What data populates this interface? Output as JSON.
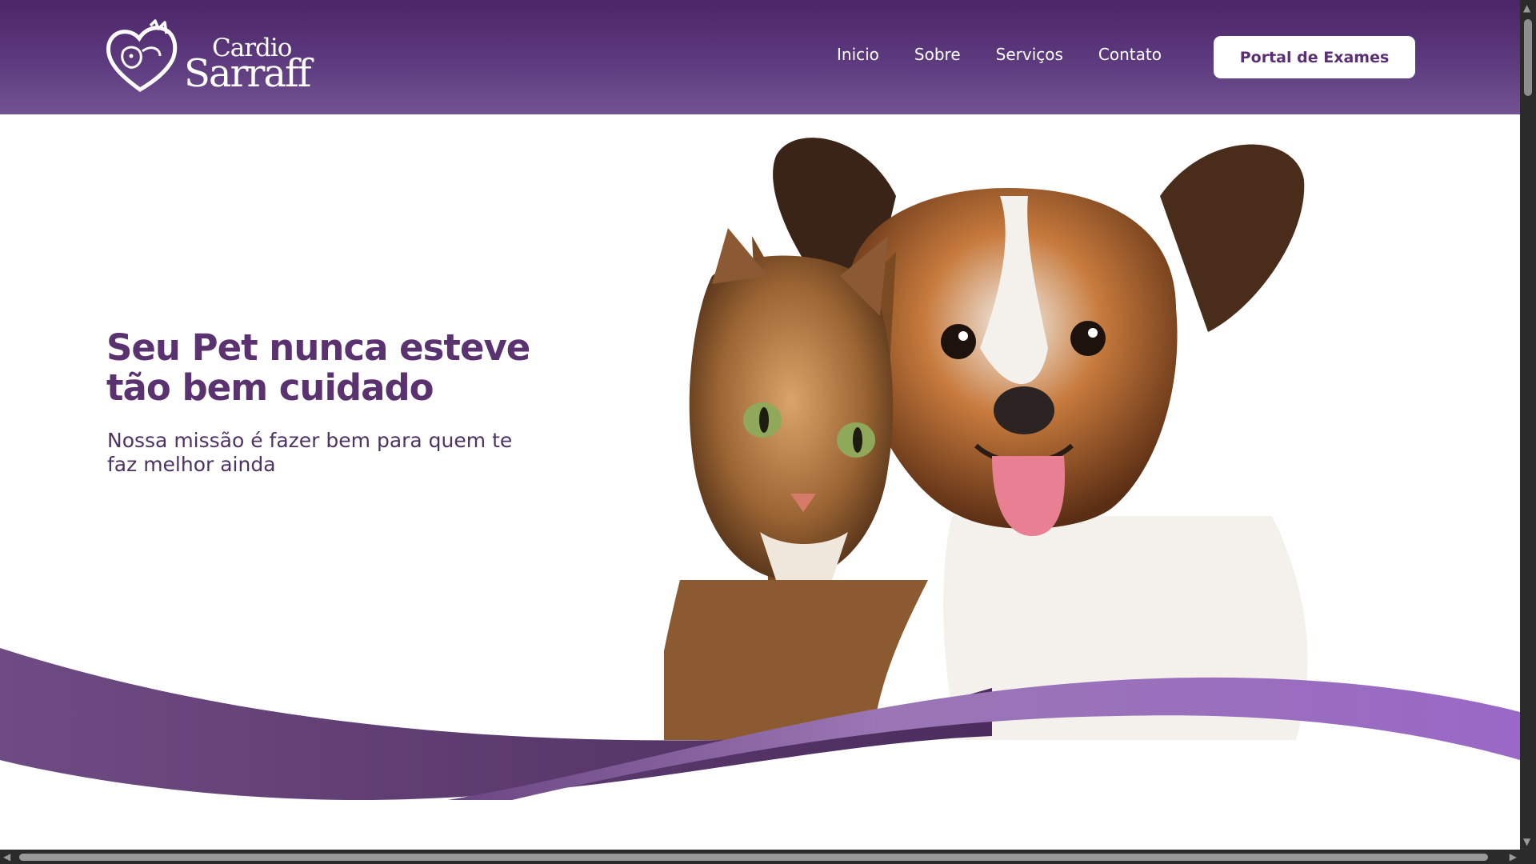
{
  "header": {
    "logo": {
      "line1": "Cardio",
      "line2": "Sarraff",
      "icon": "heart-cat-dog-logo-icon"
    },
    "nav": [
      {
        "label": "Inicio"
      },
      {
        "label": "Sobre"
      },
      {
        "label": "Serviços"
      },
      {
        "label": "Contato"
      }
    ],
    "portal_button": "Portal de Exames"
  },
  "hero": {
    "title": "Seu Pet nunca esteve tão bem cuidado",
    "subtitle": "Nossa missão é fazer bem para quem te faz melhor ainda",
    "image": "cat-and-dog-illustration"
  },
  "colors": {
    "brand_purple": "#5b3270",
    "header_dark": "#4b2567",
    "wave_light": "#9a6cc4",
    "button_bg": "#ffffff"
  },
  "scrollbars": {
    "vertical_up_icon": "arrow-up-icon",
    "vertical_down_icon": "arrow-down-icon",
    "horizontal_left_icon": "arrow-left-icon",
    "horizontal_right_icon": "arrow-right-icon"
  }
}
